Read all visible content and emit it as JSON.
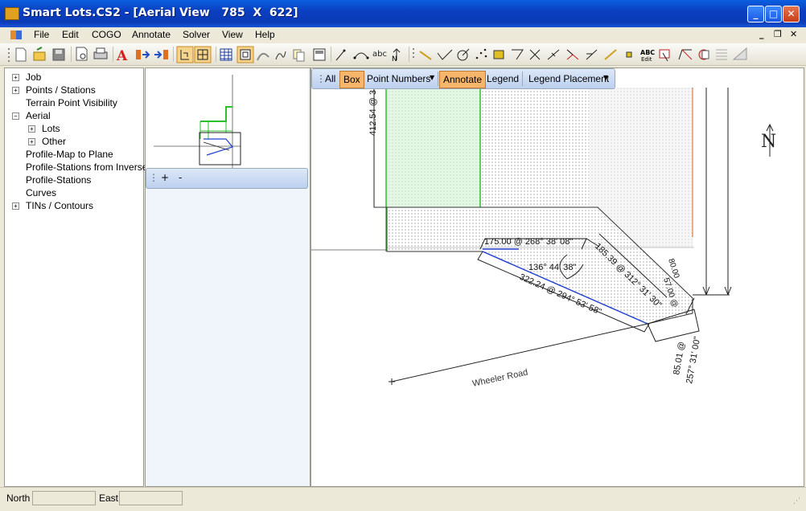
{
  "window": {
    "title": "Smart Lots.CS2 - [Aerial View   785  X  622]",
    "buttons": [
      "minimize",
      "maximize",
      "close"
    ]
  },
  "menu": {
    "items": [
      "File",
      "Edit",
      "COGO",
      "Annotate",
      "Solver",
      "View",
      "Help"
    ]
  },
  "toolbar": {
    "icons": [
      "new-file-icon",
      "open-folder-icon",
      "save-icon",
      "print-preview-icon",
      "print-icon",
      "text-style-icon",
      "export-icon",
      "import-icon",
      "select-tool-icon",
      "zoom-extent-icon",
      "grid-icon",
      "frame-icon",
      "curve-icon",
      "spiral-icon",
      "copy-icon",
      "window-icon",
      "line-icon",
      "arc-icon",
      "abc-text-icon",
      "north-arrow-icon",
      "measure-icon",
      "angle-icon",
      "circle-target-icon",
      "points-icon",
      "block-icon",
      "polyline-icon",
      "intersect-icon",
      "bisect-icon",
      "perpendicular-icon",
      "offset-icon",
      "parallel-icon",
      "point-icon",
      "abc-edit-icon",
      "annotate-icon",
      "traverse-icon",
      "layers-icon",
      "hatch-icon",
      "triangle-icon"
    ],
    "active": [
      "select-tool-icon",
      "zoom-extent-icon",
      "frame-icon"
    ]
  },
  "tree": {
    "items": [
      {
        "label": "Job",
        "expander": "+",
        "level": 0
      },
      {
        "label": "Points / Stations",
        "expander": "+",
        "level": 0
      },
      {
        "label": "Terrain Point Visibility",
        "expander": "",
        "level": 0
      },
      {
        "label": "Aerial",
        "expander": "−",
        "level": 0
      },
      {
        "label": "Lots",
        "expander": "+",
        "level": 1
      },
      {
        "label": "Other",
        "expander": "+",
        "level": 1
      },
      {
        "label": "Profile-Map to Plane",
        "expander": "",
        "level": 0
      },
      {
        "label": "Profile-Stations from Inverse",
        "expander": "",
        "level": 0
      },
      {
        "label": "Profile-Stations",
        "expander": "",
        "level": 0
      },
      {
        "label": "Curves",
        "expander": "",
        "level": 0
      },
      {
        "label": "TINs / Contours",
        "expander": "+",
        "level": 0
      }
    ]
  },
  "zoom_bar": {
    "plus": "+",
    "minus": "-"
  },
  "canvas_toolbar": {
    "all": "All",
    "box": "Box",
    "point_numbers": "Point Numbers",
    "annotate": "Annotate",
    "legend": "Legend",
    "legend_placement": "Legend Placement"
  },
  "drawing": {
    "north_label": "N",
    "road_label": "Wheeler Road",
    "dimensions": {
      "top_left": "412.54 @  3",
      "top_edge": "175.00 @ 268° 38' 08\"",
      "angle": "136° 44' 38\"",
      "long_edge": "322.24 @ 294° 53' 58\"",
      "diag_edge": "185.39 @ 312° 31' 30\"",
      "right_small": "80.00",
      "right_small_2": "57.00 @",
      "bottom_1": "85.01 @",
      "bottom_2": "257° 31' 00\""
    }
  },
  "status": {
    "north_label": "North",
    "east_label": "East",
    "north_value": "",
    "east_value": ""
  }
}
